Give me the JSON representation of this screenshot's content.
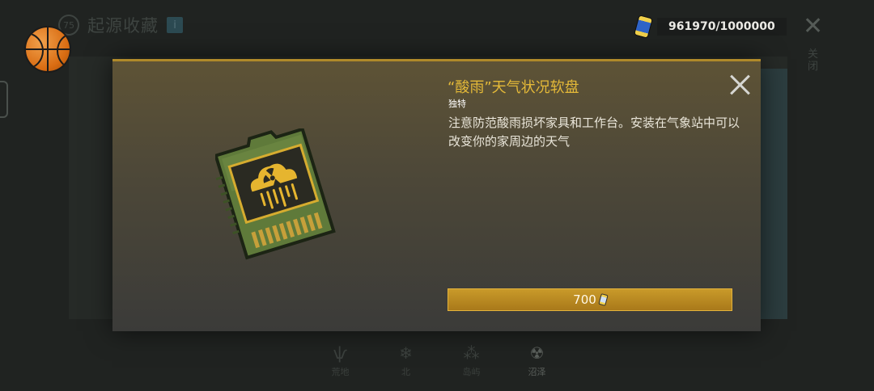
{
  "background": {
    "header_number": "75",
    "title": "起源收藏",
    "info_label": "i",
    "close_label": "✕",
    "side_label": "关闭",
    "tabs": [
      {
        "icon": "grass-icon",
        "glyph": "ѱ",
        "label": "荒地"
      },
      {
        "icon": "snowflake-icon",
        "glyph": "❄",
        "label": "北"
      },
      {
        "icon": "spores-icon",
        "glyph": "⁂",
        "label": "岛屿"
      },
      {
        "icon": "radiation-icon",
        "glyph": "☢",
        "label": "沼泽"
      }
    ]
  },
  "currency": {
    "value": "961970/1000000",
    "icon": "energy-can-icon"
  },
  "modal": {
    "title": "“酸雨”天气状况软盘",
    "rarity": "独特",
    "description": "注意防范酸雨损坏家具和工作台。安装在气象站中可以改变你的家周边的天气",
    "price": "700",
    "item_icon": "acid-rain-floppy-disk-icon",
    "accent_color": "#e4b938",
    "button_color": "#b8881f"
  }
}
